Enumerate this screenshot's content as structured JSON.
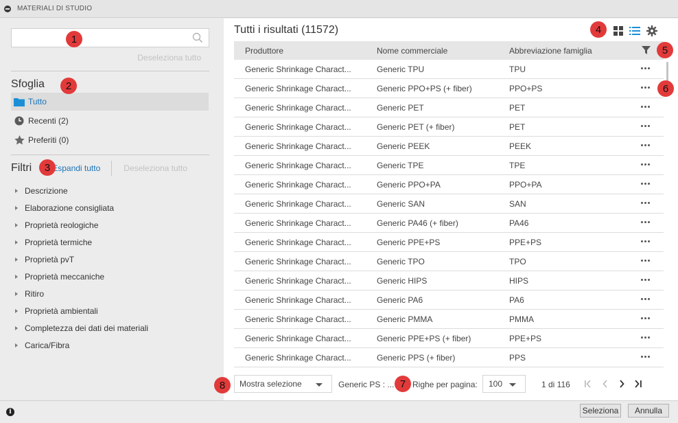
{
  "window": {
    "title": "MATERIALI DI STUDIO"
  },
  "sidebar": {
    "search": {
      "value": "",
      "placeholder": ""
    },
    "deselect_top": "Deseleziona tutto",
    "browse_title": "Sfoglia",
    "browse_items": [
      {
        "label": "Tutto",
        "icon": "folder-icon",
        "active": true
      },
      {
        "label": "Recenti (2)",
        "icon": "clock-icon",
        "active": false
      },
      {
        "label": "Preferiti (0)",
        "icon": "star-icon",
        "active": false
      }
    ],
    "filters_title": "Filtri",
    "expand_all": "Espandi tutto",
    "deselect_filters": "Deseleziona tutto",
    "filter_items": [
      "Descrizione",
      "Elaborazione consigliata",
      "Proprietà reologiche",
      "Proprietà termiche",
      "Proprietà pvT",
      "Proprietà meccaniche",
      "Ritiro",
      "Proprietà ambientali",
      "Completezza dei dati dei materiali",
      "Carica/Fibra"
    ]
  },
  "main": {
    "title": "Tutti i risultati (11572)",
    "columns": [
      "Produttore",
      "Nome commerciale",
      "Abbreviazione famiglia"
    ],
    "rows": [
      [
        "Generic Shrinkage Charact...",
        "Generic TPU",
        "TPU"
      ],
      [
        "Generic Shrinkage Charact...",
        "Generic PPO+PS (+ fiber)",
        "PPO+PS"
      ],
      [
        "Generic Shrinkage Charact...",
        "Generic PET",
        "PET"
      ],
      [
        "Generic Shrinkage Charact...",
        "Generic PET (+ fiber)",
        "PET"
      ],
      [
        "Generic Shrinkage Charact...",
        "Generic PEEK",
        "PEEK"
      ],
      [
        "Generic Shrinkage Charact...",
        "Generic TPE",
        "TPE"
      ],
      [
        "Generic Shrinkage Charact...",
        "Generic PPO+PA",
        "PPO+PA"
      ],
      [
        "Generic Shrinkage Charact...",
        "Generic SAN",
        "SAN"
      ],
      [
        "Generic Shrinkage Charact...",
        "Generic PA46 (+ fiber)",
        "PA46"
      ],
      [
        "Generic Shrinkage Charact...",
        "Generic PPE+PS",
        "PPE+PS"
      ],
      [
        "Generic Shrinkage Charact...",
        "Generic TPO",
        "TPO"
      ],
      [
        "Generic Shrinkage Charact...",
        "Generic HIPS",
        "HIPS"
      ],
      [
        "Generic Shrinkage Charact...",
        "Generic PA6",
        "PA6"
      ],
      [
        "Generic Shrinkage Charact...",
        "Generic PMMA",
        "PMMA"
      ],
      [
        "Generic Shrinkage Charact...",
        "Generic PPE+PS (+ fiber)",
        "PPE+PS"
      ],
      [
        "Generic Shrinkage Charact...",
        "Generic PPS (+ fiber)",
        "PPS"
      ]
    ]
  },
  "pager": {
    "show_selection": "Mostra selezione",
    "selected_text": "Generic PS : ...",
    "rows_per_page_label": "Righe per pagina:",
    "rows_per_page": "100",
    "page_info": "1 di 116"
  },
  "footer": {
    "select": "Seleziona",
    "cancel": "Annulla"
  },
  "callouts": [
    "1",
    "2",
    "3",
    "4",
    "5",
    "6",
    "7",
    "8"
  ],
  "colors": {
    "callout": "#e23a3a",
    "accent": "#1a73b8",
    "header_bg": "#e6e6e6"
  }
}
